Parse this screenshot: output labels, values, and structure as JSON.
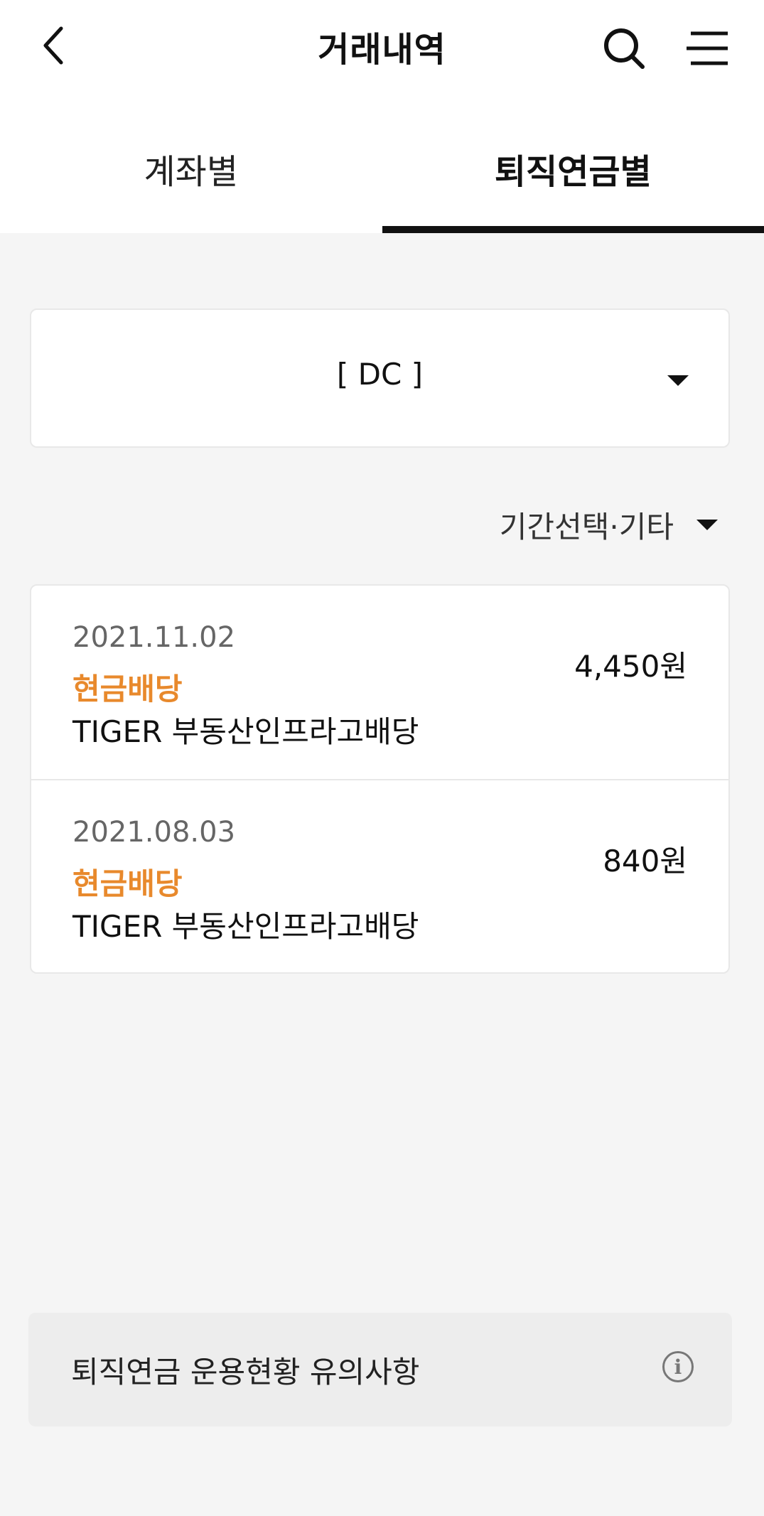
{
  "header": {
    "title": "거래내역",
    "back_icon": "chevron-left-icon",
    "search_icon": "search-icon",
    "menu_icon": "menu-icon"
  },
  "tabs": [
    {
      "label": "계좌별",
      "active": false
    },
    {
      "label": "퇴직연금별",
      "active": true
    }
  ],
  "account_select": {
    "value": "[ DC ]"
  },
  "period_filter": {
    "label": "기간선택·기타"
  },
  "transactions": [
    {
      "date": "2021.11.02",
      "type": "현금배당",
      "name": "TIGER 부동산인프라고배당",
      "amount": "4,450원"
    },
    {
      "date": "2021.08.03",
      "type": "현금배당",
      "name": "TIGER 부동산인프라고배당",
      "amount": "840원"
    }
  ],
  "notice": {
    "label": "퇴직연금 운용현황 유의사항",
    "icon": "info-icon",
    "icon_glyph": "i"
  },
  "colors": {
    "accent": "#e8892c",
    "background": "#f5f5f5",
    "text": "#111111"
  }
}
